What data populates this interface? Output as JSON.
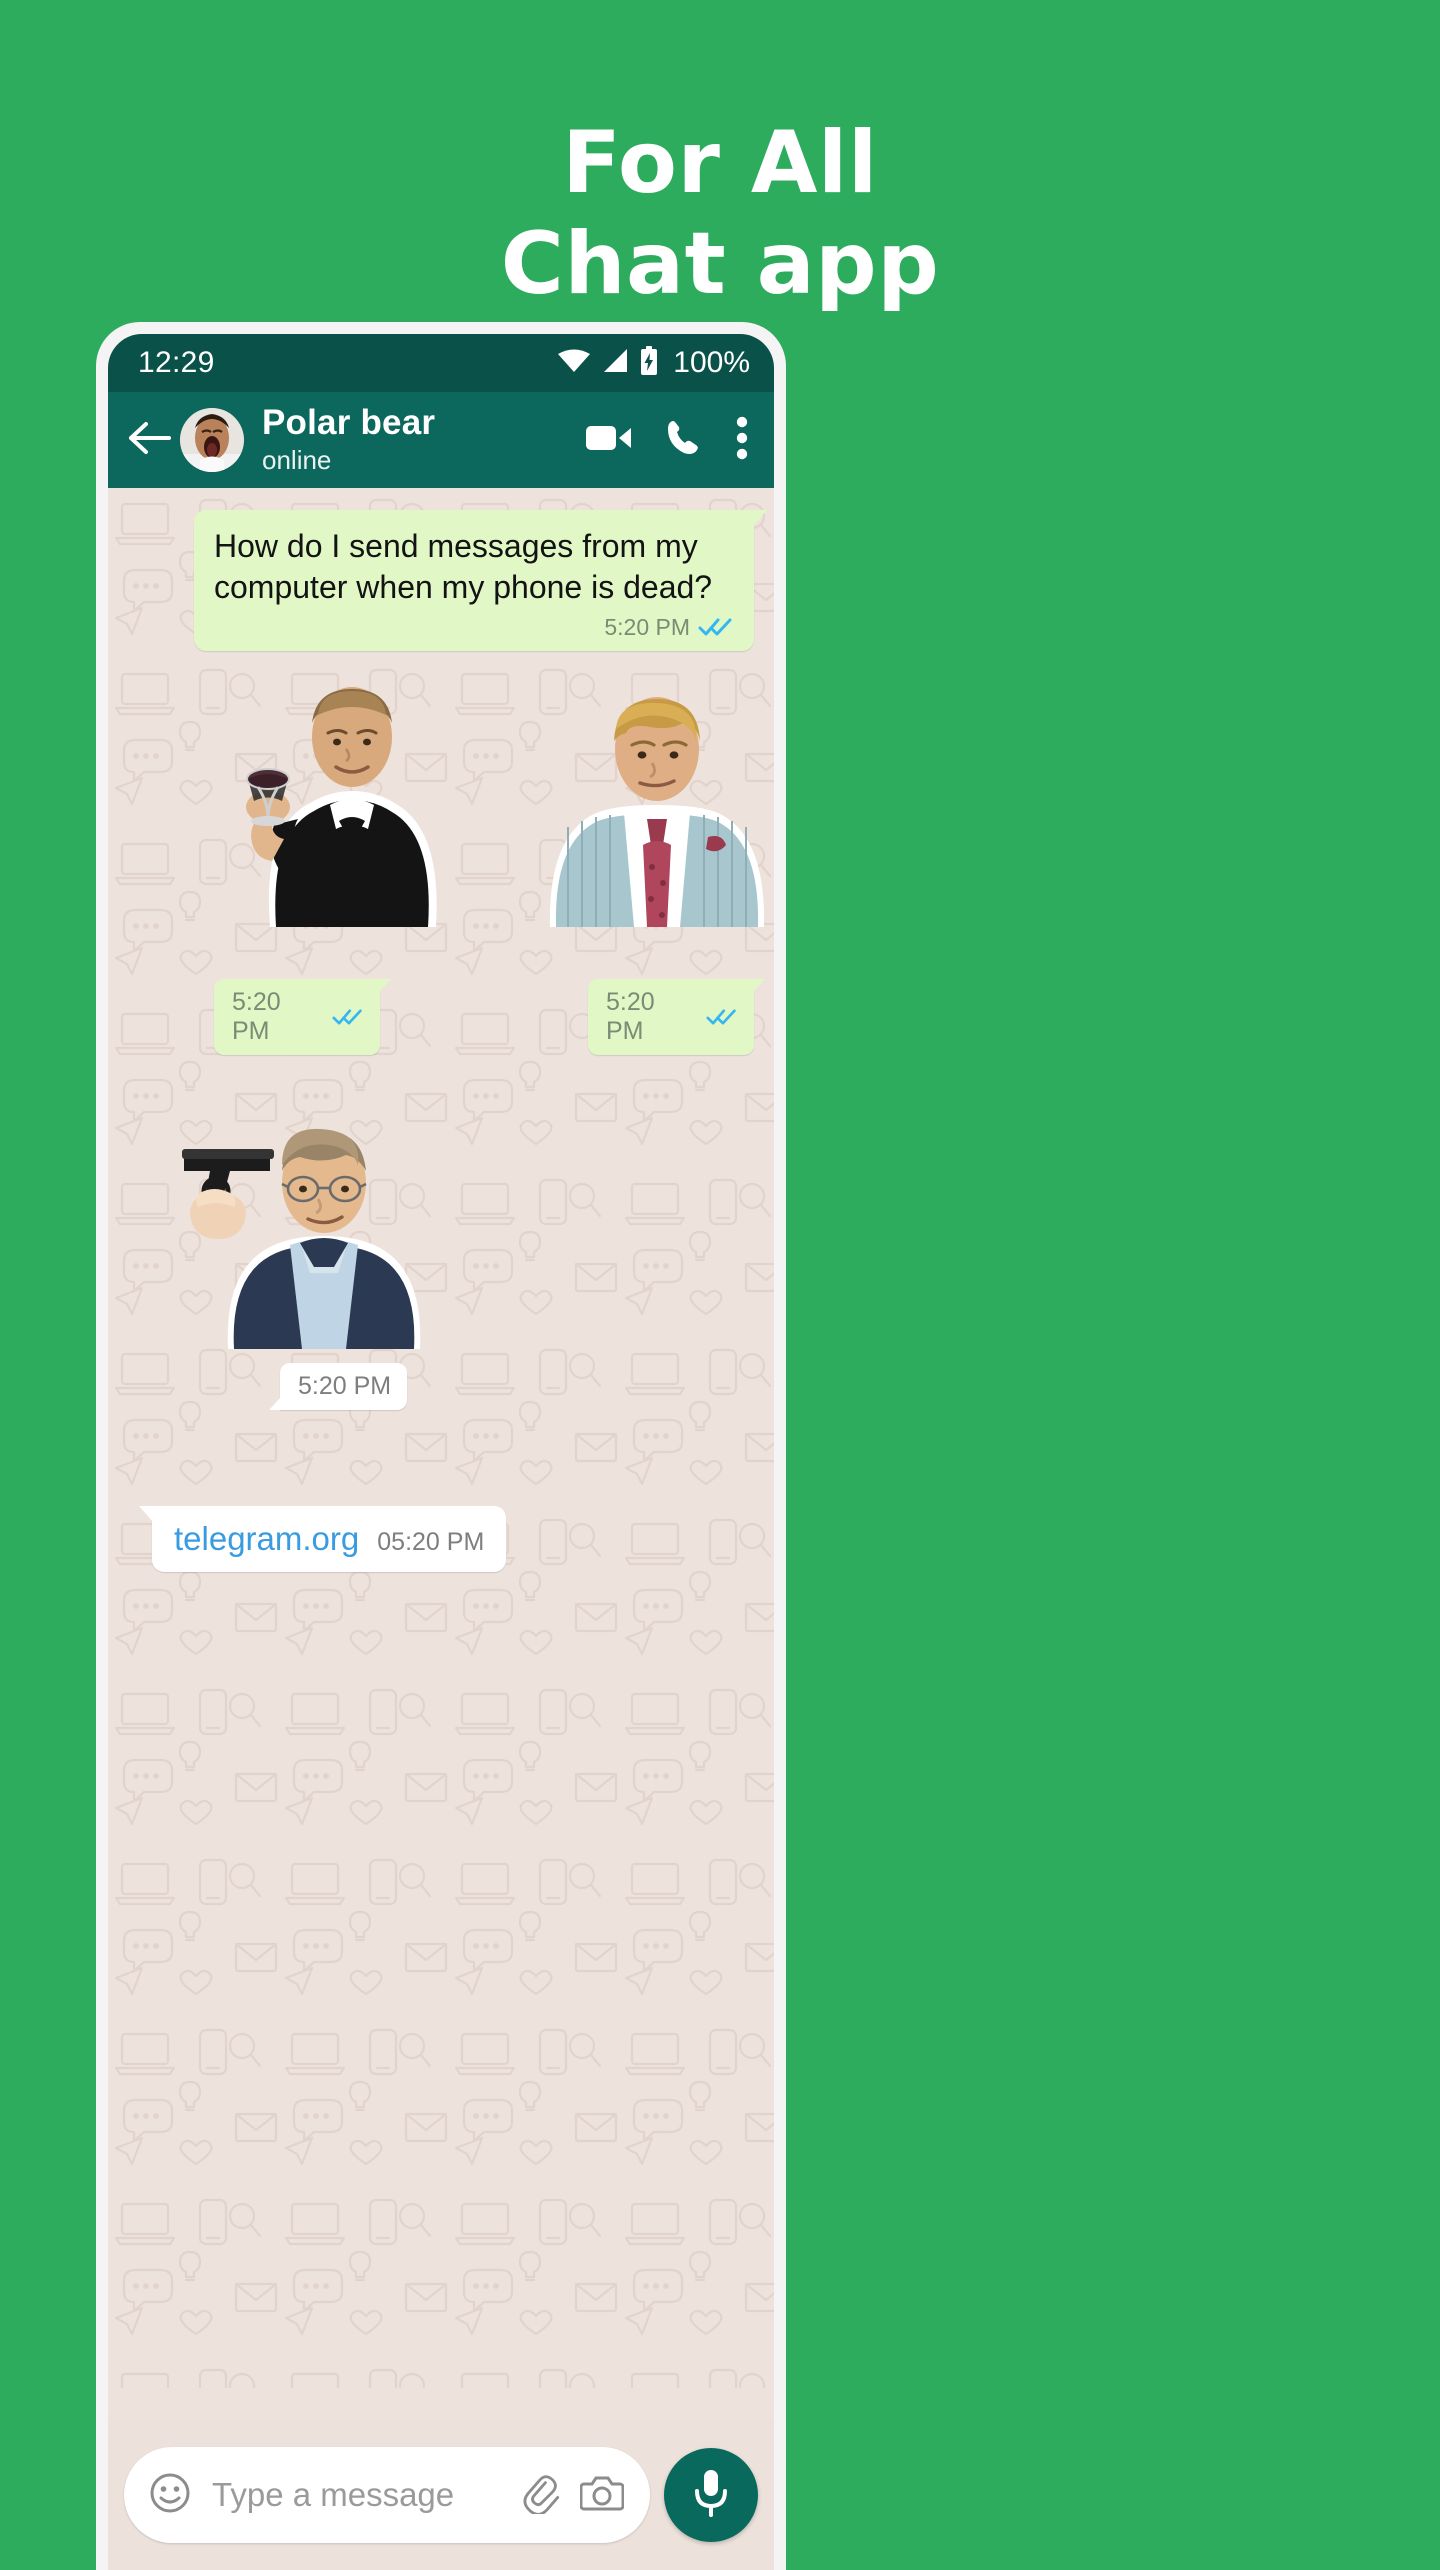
{
  "promo": {
    "line1": "For All",
    "line2": "Chat app",
    "background_color": "#2EAC5E",
    "text_color": "#FFFFFF"
  },
  "phone": {
    "statusbar": {
      "time": "12:29",
      "battery_percent": "100%",
      "icons": [
        "wifi-icon",
        "cellular-signal-icon",
        "battery-charging-icon"
      ],
      "background_color": "#0A5249"
    },
    "appbar": {
      "back_icon": "back-arrow-icon",
      "avatar": "contact-avatar",
      "title": "Polar bear",
      "subtitle": "online",
      "actions": [
        {
          "name": "video-call-button",
          "icon": "video-camera-icon"
        },
        {
          "name": "voice-call-button",
          "icon": "phone-icon"
        },
        {
          "name": "overflow-menu-button",
          "icon": "three-dots-vertical-icon"
        }
      ],
      "background_color": "#0C675C"
    },
    "chat": {
      "background_color": "#EDE2DC",
      "messages": [
        {
          "type": "text",
          "direction": "outgoing",
          "text": "How do I send messages from my computer when my phone is dead?",
          "time": "5:20 PM",
          "status": "read",
          "bubble_color": "#E1F8C6"
        },
        {
          "type": "sticker",
          "direction": "outgoing",
          "sticker_name": "leonardo-dicaprio-cheers-sticker",
          "time": "5:20 PM",
          "status": "read"
        },
        {
          "type": "sticker",
          "direction": "outgoing",
          "sticker_name": "blond-man-striped-suit-sticker",
          "time": "5:20 PM",
          "status": "read"
        },
        {
          "type": "sticker",
          "direction": "incoming",
          "sticker_name": "man-with-gun-glasses-sticker",
          "time": "5:20 PM",
          "status": "none"
        },
        {
          "type": "link",
          "direction": "incoming",
          "link_text": "telegram.org",
          "link_color": "#3A9CE0",
          "time": "05:20 PM",
          "bubble_color": "#FFFFFF"
        }
      ]
    },
    "inputbar": {
      "emoji_icon": "emoji-smiley-icon",
      "placeholder": "Type a message",
      "attach_icon": "paperclip-icon",
      "camera_icon": "camera-icon",
      "mic_icon": "microphone-icon",
      "mic_button_color": "#09695D"
    }
  }
}
